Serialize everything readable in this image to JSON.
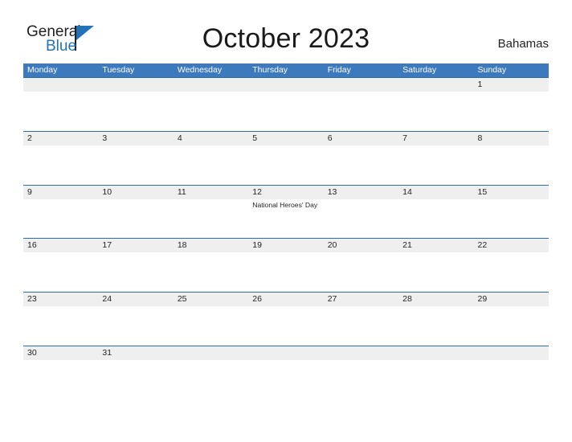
{
  "brand": {
    "name_part1": "General",
    "name_part2": "Blue",
    "flag_icon": "blue-triangle-flag"
  },
  "header": {
    "title": "October 2023",
    "locale": "Bahamas"
  },
  "colors": {
    "header_blue": "#3c79bd",
    "row_border_blue": "#2e6da4",
    "band_gray": "#efefef",
    "brand_blue": "#2272b8",
    "text_dark": "#231f20"
  },
  "calendar": {
    "month": "October",
    "year": "2023",
    "day_headers": [
      "Monday",
      "Tuesday",
      "Wednesday",
      "Thursday",
      "Friday",
      "Saturday",
      "Sunday"
    ],
    "weeks": [
      {
        "days": [
          {
            "num": "",
            "event": ""
          },
          {
            "num": "",
            "event": ""
          },
          {
            "num": "",
            "event": ""
          },
          {
            "num": "",
            "event": ""
          },
          {
            "num": "",
            "event": ""
          },
          {
            "num": "",
            "event": ""
          },
          {
            "num": "1",
            "event": ""
          }
        ]
      },
      {
        "days": [
          {
            "num": "2",
            "event": ""
          },
          {
            "num": "3",
            "event": ""
          },
          {
            "num": "4",
            "event": ""
          },
          {
            "num": "5",
            "event": ""
          },
          {
            "num": "6",
            "event": ""
          },
          {
            "num": "7",
            "event": ""
          },
          {
            "num": "8",
            "event": ""
          }
        ]
      },
      {
        "days": [
          {
            "num": "9",
            "event": ""
          },
          {
            "num": "10",
            "event": ""
          },
          {
            "num": "11",
            "event": ""
          },
          {
            "num": "12",
            "event": "National Heroes' Day"
          },
          {
            "num": "13",
            "event": ""
          },
          {
            "num": "14",
            "event": ""
          },
          {
            "num": "15",
            "event": ""
          }
        ]
      },
      {
        "days": [
          {
            "num": "16",
            "event": ""
          },
          {
            "num": "17",
            "event": ""
          },
          {
            "num": "18",
            "event": ""
          },
          {
            "num": "19",
            "event": ""
          },
          {
            "num": "20",
            "event": ""
          },
          {
            "num": "21",
            "event": ""
          },
          {
            "num": "22",
            "event": ""
          }
        ]
      },
      {
        "days": [
          {
            "num": "23",
            "event": ""
          },
          {
            "num": "24",
            "event": ""
          },
          {
            "num": "25",
            "event": ""
          },
          {
            "num": "26",
            "event": ""
          },
          {
            "num": "27",
            "event": ""
          },
          {
            "num": "28",
            "event": ""
          },
          {
            "num": "29",
            "event": ""
          }
        ]
      },
      {
        "days": [
          {
            "num": "30",
            "event": ""
          },
          {
            "num": "31",
            "event": ""
          },
          {
            "num": "",
            "event": ""
          },
          {
            "num": "",
            "event": ""
          },
          {
            "num": "",
            "event": ""
          },
          {
            "num": "",
            "event": ""
          },
          {
            "num": "",
            "event": ""
          }
        ]
      }
    ]
  }
}
